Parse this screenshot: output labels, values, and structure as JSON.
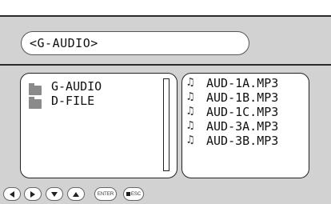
{
  "header": {
    "path": "<G-AUDIO>"
  },
  "left_panel": {
    "folders": [
      {
        "label": "G-AUDIO",
        "icon": "folder-icon"
      },
      {
        "label": "D-FILE",
        "icon": "folder-icon"
      }
    ]
  },
  "right_panel": {
    "files": [
      {
        "label": "AUD-1A.MP3",
        "icon": "music-note-icon"
      },
      {
        "label": "AUD-1B.MP3",
        "icon": "music-note-icon"
      },
      {
        "label": "AUD-1C.MP3",
        "icon": "music-note-icon"
      },
      {
        "label": "AUD-3A.MP3",
        "icon": "music-note-icon"
      },
      {
        "label": "AUD-3B.MP3",
        "icon": "music-note-icon"
      }
    ]
  },
  "buttons": {
    "enter_label": "ENTER",
    "esc_label": "ESC"
  },
  "colors": {
    "background": "#d2d2d2",
    "panel": "#ffffff",
    "border": "#222222"
  }
}
